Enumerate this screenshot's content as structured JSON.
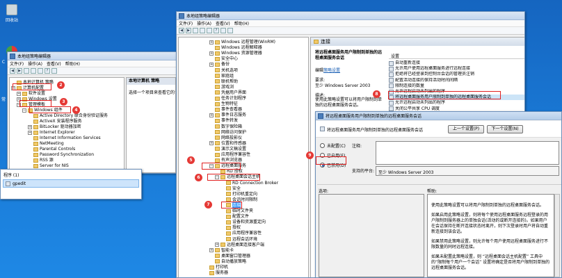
{
  "desktop": {
    "icons": [
      {
        "label": "回收站"
      },
      {
        "label": "G"
      },
      {
        "label": "C"
      },
      {
        "label": "常"
      }
    ]
  },
  "win_small": {
    "title": "本地组策略编辑器",
    "menu": [
      "文件(F)",
      "操作(A)",
      "查看(V)",
      "帮助(H)"
    ],
    "tree": [
      {
        "exp": "",
        "label": "本地计算机 策略"
      },
      {
        "exp": "−",
        "label": "计算机配置"
      },
      {
        "exp": "+",
        "label": "软件设置"
      },
      {
        "exp": "+",
        "label": "Windows 设置"
      },
      {
        "exp": "−",
        "label": "管理模板"
      },
      {
        "exp": "−",
        "label": "Windows 组件"
      },
      {
        "exp": "",
        "label": "Active Directory 联合身份验证服务"
      },
      {
        "exp": "",
        "label": "ActiveX 安装程序服务"
      },
      {
        "exp": "+",
        "label": "BitLocker 驱动器加密"
      },
      {
        "exp": "+",
        "label": "Internet Explorer"
      },
      {
        "exp": "",
        "label": "Internet Information Services"
      },
      {
        "exp": "",
        "label": "NetMeeting"
      },
      {
        "exp": "",
        "label": "Parental Controls"
      },
      {
        "exp": "",
        "label": "Password Synchronization"
      },
      {
        "exp": "",
        "label": "RSS 源"
      },
      {
        "exp": "",
        "label": "Server for NIS"
      }
    ],
    "right_header": "本地计算机 策略",
    "right_text": "选择一个项目来查看它的说",
    "badges": [
      "2",
      "3",
      "4"
    ]
  },
  "run_box": {
    "title": "程序 (1)",
    "item": "gpedit"
  },
  "win_big": {
    "title": "本地组策略编辑器",
    "menu": [
      "文件(F)",
      "操作(A)",
      "查看(V)",
      "帮助(H)"
    ],
    "tree": [
      {
        "exp": "+",
        "label": "Windows 远程管理(WinRM)",
        "lvl": 2
      },
      {
        "exp": "",
        "label": "Windows 远程解释器",
        "lvl": 2
      },
      {
        "exp": "+",
        "label": "Windows 资源管理器",
        "lvl": 2
      },
      {
        "exp": "",
        "label": "安全中心",
        "lvl": 2
      },
      {
        "exp": "+",
        "label": "备份",
        "lvl": 2
      },
      {
        "exp": "",
        "label": "关机选项",
        "lvl": 2
      },
      {
        "exp": "",
        "label": "家庭组",
        "lvl": 2
      },
      {
        "exp": "",
        "label": "联机帮助",
        "lvl": 2
      },
      {
        "exp": "",
        "label": "游戏浏",
        "lvl": 2
      },
      {
        "exp": "",
        "label": "凭据用户界面",
        "lvl": 2
      },
      {
        "exp": "",
        "label": "任务计划程序",
        "lvl": 2
      },
      {
        "exp": "",
        "label": "生物特征",
        "lvl": 2
      },
      {
        "exp": "",
        "label": "事件查看器",
        "lvl": 2
      },
      {
        "exp": "+",
        "label": "事件日志服务",
        "lvl": 2
      },
      {
        "exp": "",
        "label": "事件转发",
        "lvl": 2
      },
      {
        "exp": "",
        "label": "数字保险箱",
        "lvl": 2
      },
      {
        "exp": "",
        "label": "网络访问保护",
        "lvl": 2
      },
      {
        "exp": "",
        "label": "网络投影仪",
        "lvl": 2
      },
      {
        "exp": "+",
        "label": "位置和传感器",
        "lvl": 2
      },
      {
        "exp": "",
        "label": "演示文稿设置",
        "lvl": 2
      },
      {
        "exp": "",
        "label": "应用程序兼容性",
        "lvl": 2
      },
      {
        "exp": "",
        "label": "有声浏览器",
        "lvl": 2
      },
      {
        "exp": "−",
        "label": "远程桌面服务",
        "lvl": 2
      },
      {
        "exp": "",
        "label": "RD 授权",
        "lvl": 3
      },
      {
        "exp": "−",
        "label": "远程桌面会话主机",
        "lvl": 3
      },
      {
        "exp": "",
        "label": "RD Connection Broker",
        "lvl": 4
      },
      {
        "exp": "",
        "label": "安全",
        "lvl": 4
      },
      {
        "exp": "",
        "label": "打印机重定向",
        "lvl": 4
      },
      {
        "exp": "",
        "label": "会话时间限制",
        "lvl": 4
      },
      {
        "exp": "",
        "label": "连接",
        "lvl": 4
      },
      {
        "exp": "",
        "label": "临时文件夹",
        "lvl": 4
      },
      {
        "exp": "",
        "label": "配置文件",
        "lvl": 4
      },
      {
        "exp": "",
        "label": "设备和资源重定向",
        "lvl": 4
      },
      {
        "exp": "",
        "label": "授权",
        "lvl": 4
      },
      {
        "exp": "",
        "label": "应用程序兼容性",
        "lvl": 4
      },
      {
        "exp": "",
        "label": "远程会话环境",
        "lvl": 4
      },
      {
        "exp": "+",
        "label": "远程桌面连接客户端",
        "lvl": 3
      },
      {
        "exp": "+",
        "label": "智能卡",
        "lvl": 2
      },
      {
        "exp": "",
        "label": "桌面窗口管理器",
        "lvl": 2
      },
      {
        "exp": "",
        "label": "自动播放策略",
        "lvl": 2
      },
      {
        "exp": "",
        "label": "打印机",
        "lvl": 1
      },
      {
        "exp": "",
        "label": "服务器",
        "lvl": 1
      }
    ],
    "section_header": "连接",
    "desc_title": "将远程桌面服务用户限制到单独的远程桌面服务会话",
    "edit_prefix": "编辑",
    "edit_link": "策略设置",
    "req_label": "要求:",
    "req_text": "至少 Windows Server 2003",
    "desc_label": "描述:",
    "desc_text": "使用此策略设置可以将用户限制到单独的远程桌面服务会话。",
    "settings_header": "设置",
    "settings": [
      "自动重新连接",
      "允许用户使用远程桌面服务进行远程连接",
      "拒绝将已经登录到控制台会话的管理员注销",
      "配置活动连接的保持活动时间间隔",
      "限制连接的数量",
      "允许远程启动未列出的程序",
      "将远程桌面服务用户限制到单独的远程桌面服务会话",
      "允许远程启动未列出的程序",
      "关闭公平共享 CPU 调度"
    ],
    "badges": [
      "5",
      "6",
      "7",
      "8"
    ]
  },
  "dialog": {
    "title": "将远程桌面服务用户限制到单独的远程桌面服务会话",
    "header_text": "将远程桌面服务用户限制到单独的远程桌面服务会话",
    "prev_button": "上一个设置(P)",
    "next_button": "下一个设置(N)",
    "radios": [
      "未配置(C)",
      "已启用(E)",
      "已禁用(D)"
    ],
    "comment_label": "注释:",
    "platform_label": "支持的平台:",
    "platform_text": "至少 Windows Server 2003",
    "options_label": "选项:",
    "help_label": "帮助:",
    "help_paragraphs": [
      "使用此策略设置可以将用户限制到单独的远程桌面服务会话。",
      "如果启用此策略设置，则将每个使用远程桌面服务远程登录的用户限制到服务器上的单独会话(活动的或断开连接的)。如果用户在会话保持在断开连接状态时离开，则下次登录时用户将自动重新连接到该会话。",
      "如果禁用此策略设置，则允许每个用户使用远程桌面服务进行不限数量的同时远程连接。",
      "如果未配置此策略设置，则 “远程桌面会话主机配置” 工具中的“限制每个用户一个会话” 设置将确定是否将用户限制到单独的远程桌面服务会话。"
    ],
    "badge": "9"
  }
}
